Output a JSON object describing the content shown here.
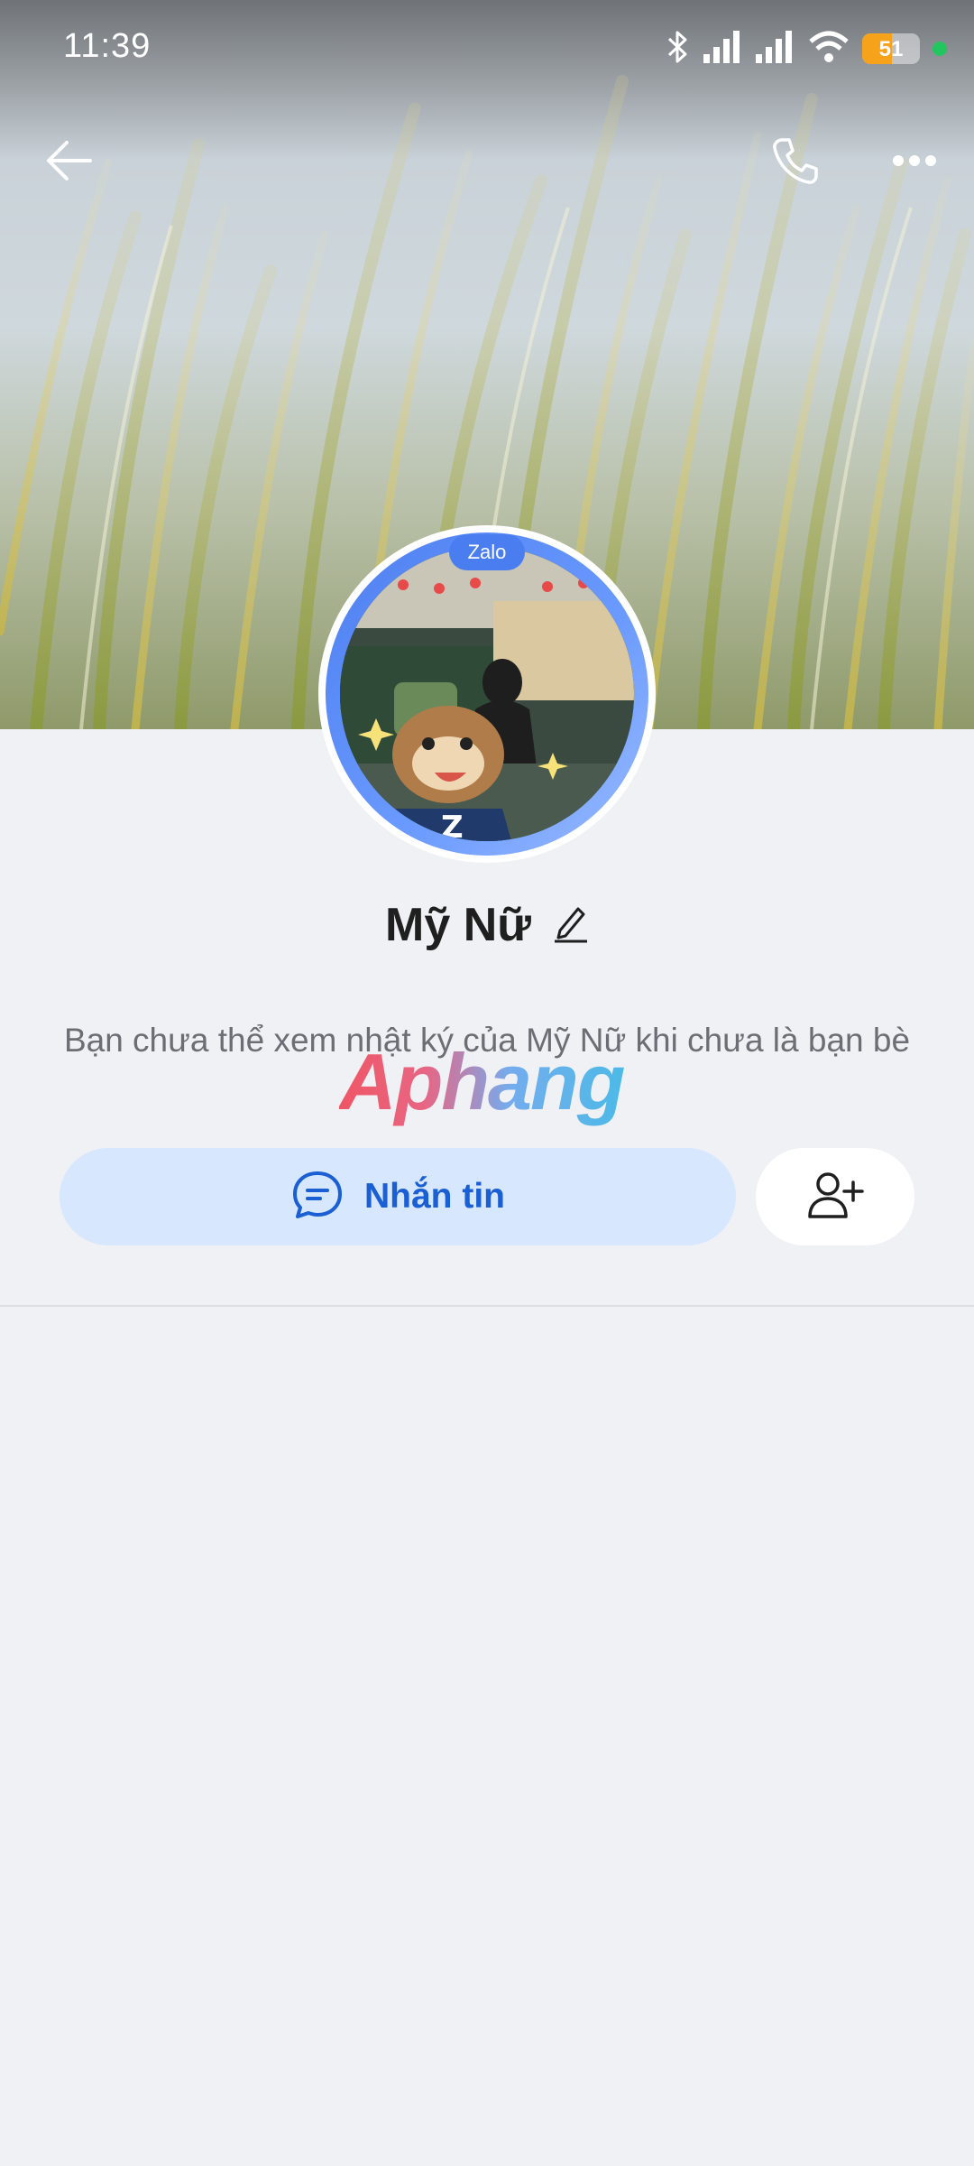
{
  "status_bar": {
    "time": "11:39",
    "battery_level": "51",
    "battery_fraction": 0.51,
    "icons": [
      "bluetooth-icon",
      "signal-icon",
      "signal-icon",
      "wifi-icon",
      "battery-icon",
      "privacy-dot-icon"
    ]
  },
  "colors": {
    "accent": "#1a5fd3",
    "button_bg": "#d7e7fd",
    "page_bg": "#f0f1f5",
    "battery": "#f7a21b",
    "dot": "#22c55e"
  },
  "top_bar": {
    "icons": [
      "back-arrow-icon",
      "phone-icon",
      "more-dots-icon"
    ]
  },
  "profile": {
    "badge": "Zalo",
    "name": "Mỹ Nữ",
    "notice": "Bạn chưa thể xem nhật ký của Mỹ Nữ khi chưa là bạn bè",
    "watermark": "Aphang"
  },
  "actions": {
    "message_label": "Nhắn tin",
    "message_icon": "chat-bubble-icon",
    "add_friend_icon": "add-friend-icon"
  }
}
